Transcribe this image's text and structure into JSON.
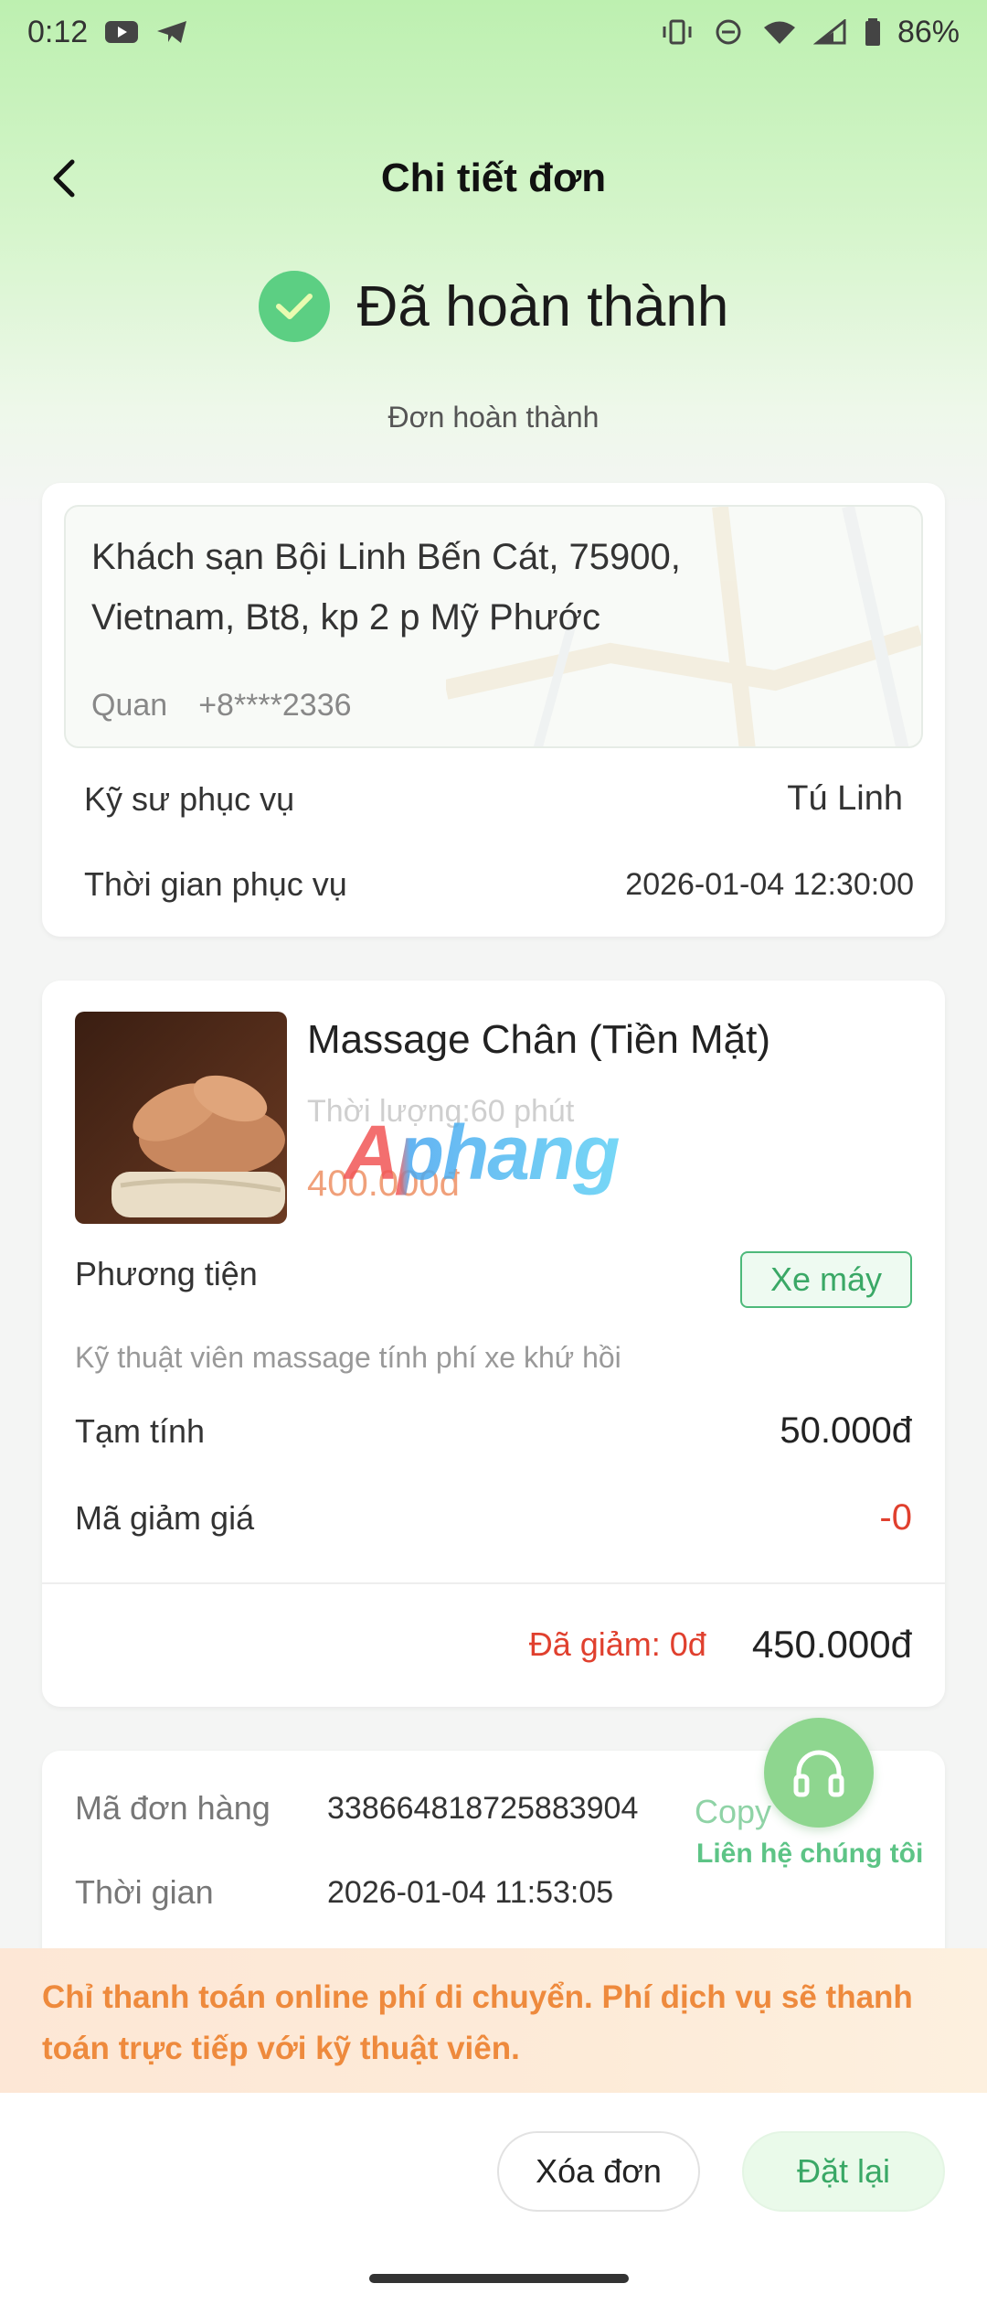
{
  "status_bar": {
    "time": "0:12",
    "battery": "86%",
    "left_icons": [
      "youtube-icon",
      "telegram-icon"
    ],
    "right_icons": [
      "vibrate-icon",
      "dnd-icon",
      "wifi-icon",
      "signal-icon",
      "battery-icon"
    ]
  },
  "header": {
    "title": "Chi tiết đơn",
    "back_icon": "chevron-left-icon"
  },
  "order_status": {
    "title": "Đã hoàn thành",
    "subtitle": "Đơn hoàn thành",
    "icon": "check-circle-icon",
    "icon_color": "#5ccf83"
  },
  "address_card": {
    "address": "Khách sạn Bội Linh Bến Cát, 75900, Vietnam, Bt8, kp 2 p Mỹ Phước",
    "contact_name": "Quan",
    "contact_phone": "+8****2336",
    "rows": [
      {
        "label": "Kỹ sư phục vụ",
        "value": "Tú Linh"
      },
      {
        "label": "Thời gian phục vụ",
        "value": "2026-01-04 12:30:00"
      }
    ]
  },
  "service_card": {
    "name": "Massage Chân (Tiền Mặt)",
    "duration": "Thời lượng:60 phút",
    "price": "400.000đ",
    "watermark": "Aphang",
    "vehicle_label": "Phương tiện",
    "vehicle_value": "Xe máy",
    "vehicle_note": "Kỹ thuật viên massage tính phí xe khứ hồi",
    "subtotal_label": "Tạm tính",
    "subtotal_value": "50.000đ",
    "coupon_label": "Mã giảm giá",
    "coupon_value": "-0",
    "discount_text": "Đã giảm: 0đ",
    "total": "450.000đ"
  },
  "order_info": {
    "order_code_label": "Mã đơn hàng",
    "order_code": "338664818725883904",
    "copy_label": "Copy",
    "time_label": "Thời gian",
    "time_value": "2026-01-04 11:53:05"
  },
  "contact": {
    "label": "Liên hệ chúng tôi",
    "icon": "headphones-icon"
  },
  "notice": {
    "text": "Chỉ thanh toán online phí di chuyển. Phí dịch vụ sẽ thanh toán trực tiếp với kỹ thuật viên."
  },
  "actions": {
    "delete_label": "Xóa đơn",
    "reorder_label": "Đặt lại"
  },
  "colors": {
    "accent_green": "#3aa866",
    "price_orange": "#f0a07a",
    "discount_red": "#e0402e",
    "notice_orange": "#ee8a3d"
  }
}
